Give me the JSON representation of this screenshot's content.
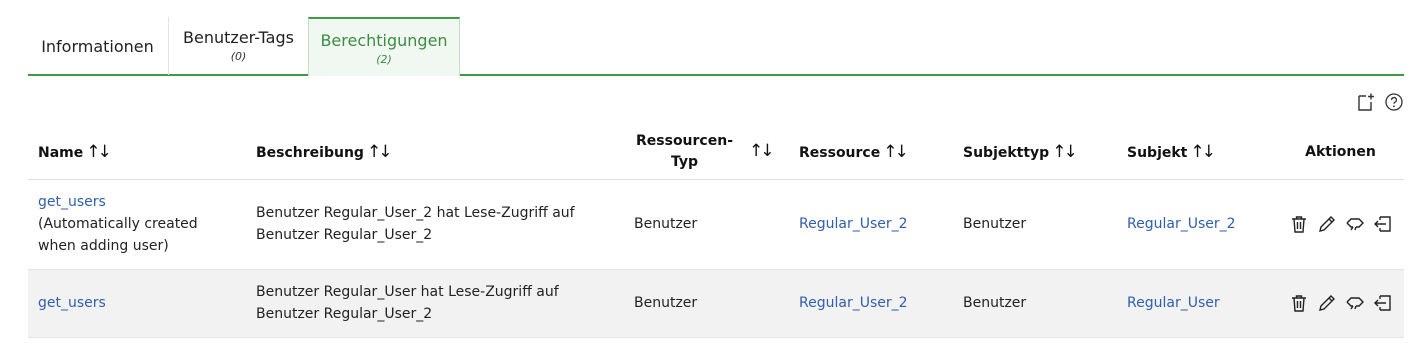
{
  "tabs": [
    {
      "label": "Informationen",
      "count": ""
    },
    {
      "label": "Benutzer-Tags",
      "count": "(0)"
    },
    {
      "label": "Berechtigungen",
      "count": "(2)"
    }
  ],
  "active_tab": "Berechtigungen",
  "toolbar": {
    "icons": [
      "new-document-icon",
      "help-icon"
    ]
  },
  "table": {
    "headers": {
      "name": "Name",
      "description": "Beschreibung",
      "resource_type_line1": "Ressourcen-",
      "resource_type_line2": "Typ",
      "resource": "Ressource",
      "subject_type": "Subjekttyp",
      "subject": "Subjekt",
      "actions": "Aktionen"
    },
    "sort_glyph": "↑↓",
    "rows": [
      {
        "name": "get_users",
        "note_line1": "(Automatically created",
        "note_line2": "when adding user)",
        "description_line1": "Benutzer Regular_User_2 hat Lese-Zugriff auf",
        "description_line2": "Benutzer Regular_User_2",
        "resource_type": "Benutzer",
        "resource": "Regular_User_2",
        "subject_type": "Benutzer",
        "subject": "Regular_User_2"
      },
      {
        "name": "get_users",
        "description_line1": "Benutzer Regular_User hat Lese-Zugriff auf",
        "description_line2": "Benutzer Regular_User_2",
        "resource_type": "Benutzer",
        "resource": "Regular_User_2",
        "subject_type": "Benutzer",
        "subject": "Regular_User"
      }
    ],
    "action_icons": [
      "trash-icon",
      "pencil-icon",
      "transfer-icon",
      "exit-icon"
    ],
    "link_color": "#2f5fad"
  },
  "accent_color": "#3f9a46"
}
